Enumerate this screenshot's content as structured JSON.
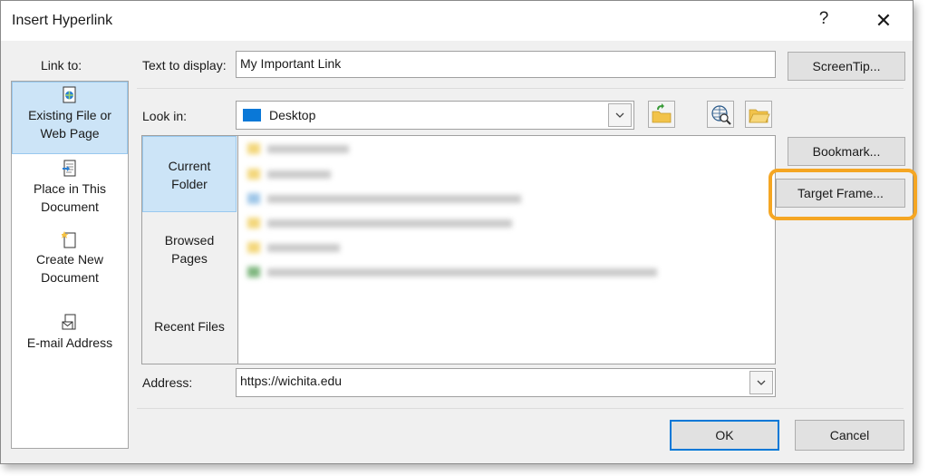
{
  "window": {
    "title": "Insert Hyperlink",
    "help": "?",
    "close": "✕"
  },
  "text_to_display": {
    "label": "Text to display:",
    "value": "My Important Link"
  },
  "screentip_label": "ScreenTip...",
  "link_to": {
    "label": "Link to:",
    "items": [
      {
        "label": "Existing File or Web Page",
        "line1": "Existing File or",
        "line2": "Web Page",
        "icon": "existing-file-icon"
      },
      {
        "label": "Place in This Document",
        "line1": "Place in This",
        "line2": "Document",
        "icon": "place-in-document-icon"
      },
      {
        "label": "Create New Document",
        "line1": "Create New",
        "line2": "Document",
        "icon": "new-document-icon"
      },
      {
        "label": "E-mail Address",
        "line1": "E-mail Address",
        "line2": "",
        "icon": "email-icon"
      }
    ]
  },
  "look_in": {
    "label": "Look in:",
    "value": "Desktop"
  },
  "look_tabs": [
    {
      "line1": "Current",
      "line2": "Folder"
    },
    {
      "line1": "Browsed",
      "line2": "Pages"
    },
    {
      "line1": "Recent Files",
      "line2": ""
    }
  ],
  "bookmark_label": "Bookmark...",
  "target_frame_label": "Target Frame...",
  "address": {
    "label": "Address:",
    "value": "https://wichita.edu"
  },
  "ok_label": "OK",
  "cancel_label": "Cancel",
  "colors": {
    "selection": "#cce4f7",
    "highlight": "#f5a623",
    "ok_border": "#0078d7"
  }
}
